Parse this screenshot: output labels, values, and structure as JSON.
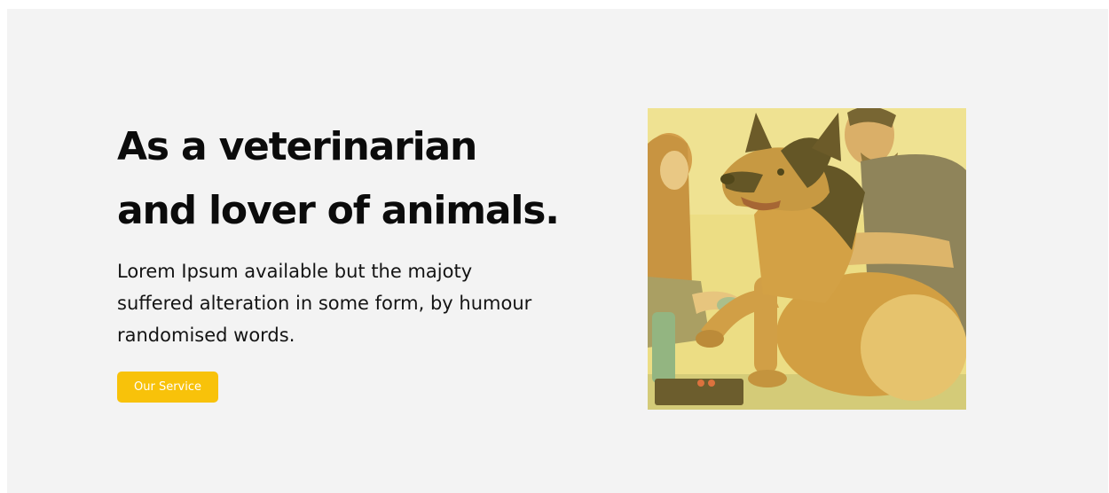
{
  "hero": {
    "headline_line1": "As a veterinarian",
    "headline_line2": "and lover of animals.",
    "description": "Lorem Ipsum available but the majoty suffered alteration in some form, by humour randomised words.",
    "cta_label": "Our Service"
  },
  "colors": {
    "background": "#f3f3f3",
    "accent": "#f8c20a",
    "text": "#0b0b0b",
    "photo_tint": "#e6d77f"
  },
  "image": {
    "subject": "veterinarians-with-german-shepherd-photo"
  }
}
